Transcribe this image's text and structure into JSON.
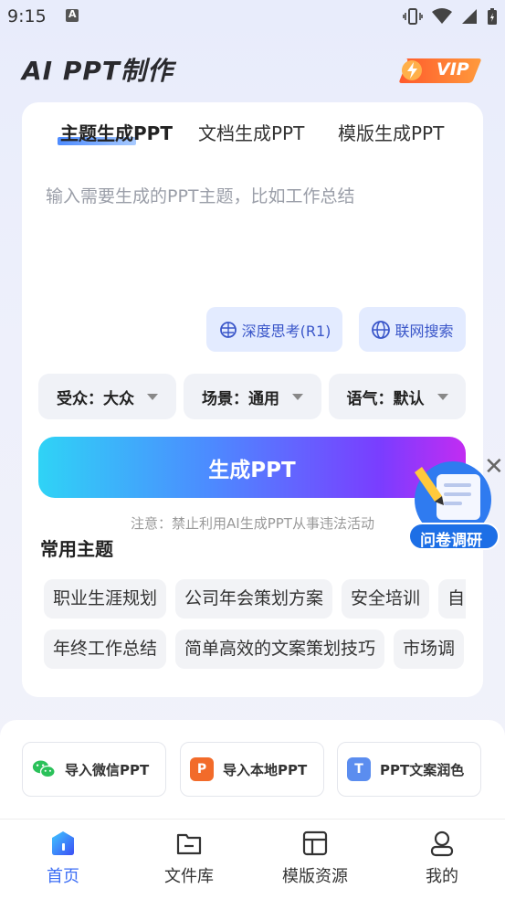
{
  "status": {
    "time": "9:15"
  },
  "header": {
    "title": "AI PPT制作",
    "vip_label": "VIP"
  },
  "tabs": [
    {
      "label": "主题生成PPT",
      "active": true
    },
    {
      "label": "文档生成PPT",
      "active": false
    },
    {
      "label": "模版生成PPT",
      "active": false
    }
  ],
  "input": {
    "placeholder": "输入需要生成的PPT主题，比如工作总结"
  },
  "options": {
    "deep_think": "深度思考(R1)",
    "web_search": "联网搜索"
  },
  "selectors": [
    {
      "label": "受众：大众"
    },
    {
      "label": "场景：通用"
    },
    {
      "label": "语气：默认"
    }
  ],
  "generate_label": "生成PPT",
  "notice": "注意：禁止利用AI生成PPT从事违法活动",
  "common_topics": {
    "title": "常用主题",
    "row1": [
      "职业生涯规划",
      "公司年会策划方案",
      "安全培训",
      "自"
    ],
    "row2": [
      "年终工作总结",
      "简单高效的文案策划技巧",
      "市场调"
    ]
  },
  "survey": {
    "label": "问卷调研"
  },
  "tools": [
    {
      "label": "导入微信PPT",
      "icon": "wechat-icon",
      "color": "#2bc15a"
    },
    {
      "label": "导入本地PPT",
      "icon": "ppt-file-icon",
      "color": "#f26b2a"
    },
    {
      "label": "PPT文案润色",
      "icon": "text-polish-icon",
      "color": "#5b8def"
    }
  ],
  "nav": [
    {
      "label": "首页",
      "icon": "home-icon",
      "active": true
    },
    {
      "label": "文件库",
      "icon": "folder-icon",
      "active": false
    },
    {
      "label": "模版资源",
      "icon": "template-icon",
      "active": false
    },
    {
      "label": "我的",
      "icon": "profile-icon",
      "active": false
    }
  ],
  "colors": {
    "accent": "#3c6ef5",
    "chip_bg": "#e3ebff"
  }
}
